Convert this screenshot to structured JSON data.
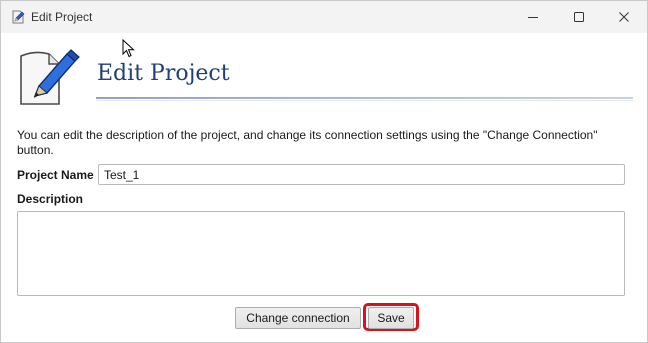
{
  "window": {
    "title": "Edit Project",
    "icons": {
      "app": "pencil-paper-icon",
      "minimize": "minimize-icon",
      "maximize": "maximize-icon",
      "close": "close-icon"
    }
  },
  "header": {
    "title": "Edit Project",
    "icon": "edit-document-icon",
    "title_color": "#1e3f78"
  },
  "form": {
    "instructions": "You can edit the description of the project, and change its connection settings using the \"Change Connection\" button.",
    "project_name_label": "Project Name",
    "project_name_value": "Test_1",
    "description_label": "Description",
    "description_value": ""
  },
  "buttons": {
    "change_connection": "Change connection",
    "save": "Save"
  },
  "highlight_color": "#d8121b"
}
